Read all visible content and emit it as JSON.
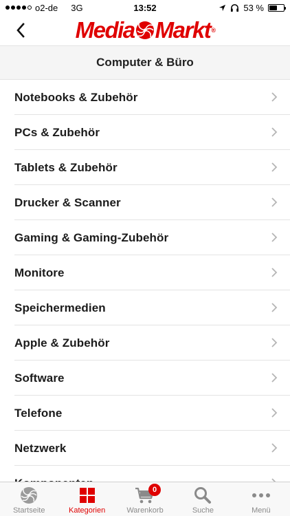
{
  "status_bar": {
    "carrier": "o2-de",
    "network": "3G",
    "time": "13:52",
    "battery_text": "53 %",
    "battery_level": 0.53
  },
  "header": {
    "logo_text": "MediaMarkt",
    "logo_part1": "Media",
    "logo_part2": "Markt",
    "brand_color": "#df0000"
  },
  "section": {
    "title": "Computer & Büro"
  },
  "categories": [
    {
      "label": "Notebooks & Zubehör"
    },
    {
      "label": "PCs & Zubehör"
    },
    {
      "label": "Tablets & Zubehör"
    },
    {
      "label": "Drucker & Scanner"
    },
    {
      "label": "Gaming & Gaming-Zubehör"
    },
    {
      "label": "Monitore"
    },
    {
      "label": "Speichermedien"
    },
    {
      "label": "Apple & Zubehör"
    },
    {
      "label": "Software"
    },
    {
      "label": "Telefone"
    },
    {
      "label": "Netzwerk"
    },
    {
      "label": "Komponenten"
    }
  ],
  "tabbar": {
    "tabs": [
      {
        "label": "Startseite",
        "icon": "home-disc-icon",
        "active": false
      },
      {
        "label": "Kategorien",
        "icon": "grid-icon",
        "active": true
      },
      {
        "label": "Warenkorb",
        "icon": "cart-icon",
        "active": false,
        "badge": "0"
      },
      {
        "label": "Suche",
        "icon": "search-icon",
        "active": false
      },
      {
        "label": "Menü",
        "icon": "more-dots-icon",
        "active": false
      }
    ]
  },
  "colors": {
    "accent": "#df0000",
    "inactive": "#8a8a8a",
    "separator": "#e3e3e3"
  }
}
